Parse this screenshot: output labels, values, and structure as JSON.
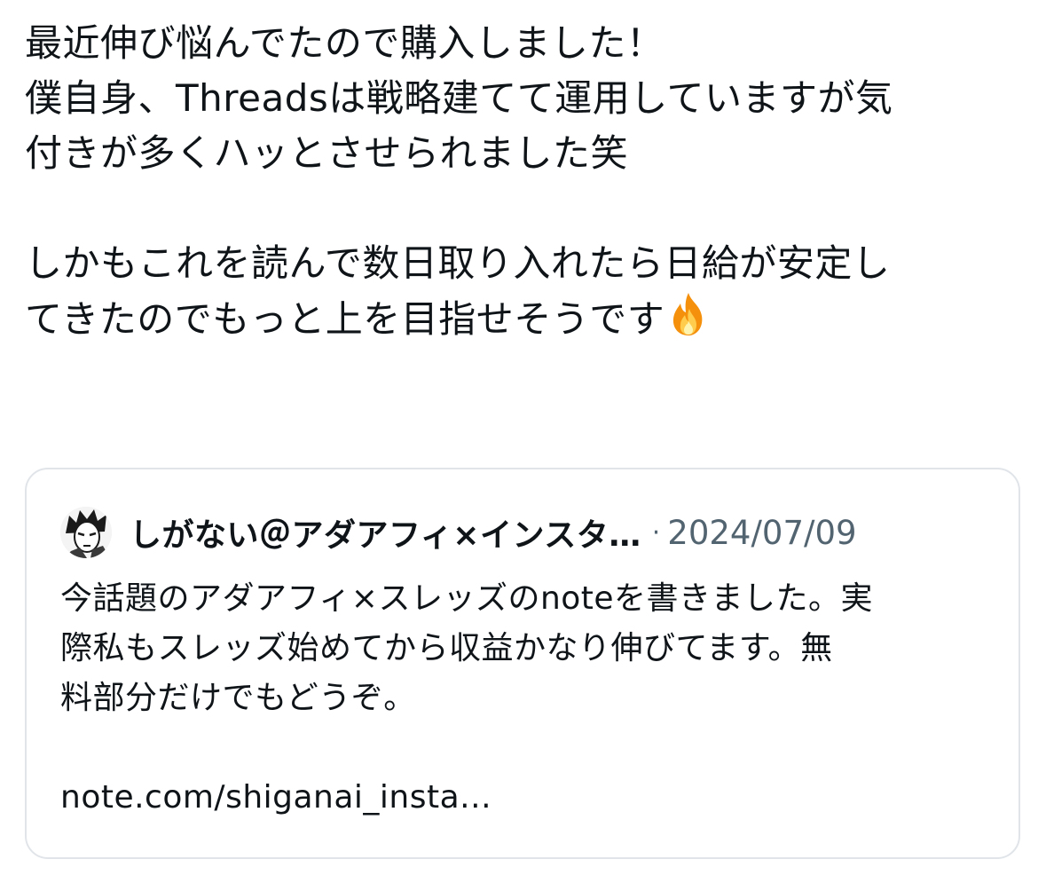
{
  "post": {
    "lines": [
      "最近伸び悩んでたので購入しました！",
      "僕自身、Threadsは戦略建てて運用していますが気",
      "付きが多くハッとさせられました笑",
      "しかもこれを読んで数日取り入れたら日給が安定し",
      "てきたのでもっと上を目指せそうです"
    ],
    "emoji_icon": "fire-emoji"
  },
  "quote": {
    "author_name": "しがない＠アダアフィ×インスタ…",
    "separator": "·",
    "date": "2024/07/09",
    "avatar_icon": "manga-character-avatar",
    "lines": [
      "今話題のアダアフィ×スレッズのnoteを書きました。実",
      "際私もスレッズ始めてから収益かなり伸びてます。無",
      "料部分だけでもどうぞ。"
    ],
    "link": "note.com/shiganai_insta..."
  },
  "colors": {
    "text_primary": "#0f1419",
    "text_secondary": "#536471",
    "card_border": "#e1e5e9",
    "background": "#ffffff"
  }
}
